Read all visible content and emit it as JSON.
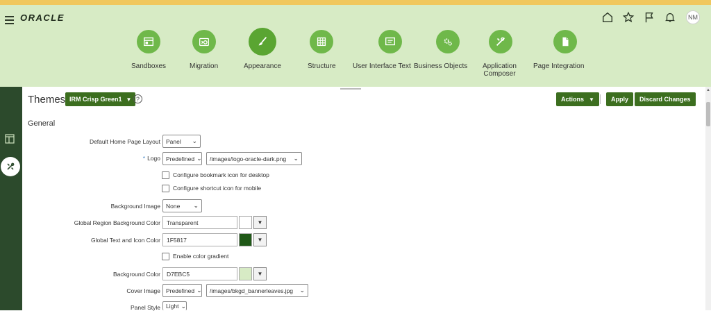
{
  "header": {
    "logo": "ORACLE",
    "avatar_initials": "NM",
    "icons": [
      "home-icon",
      "favorites-star-icon",
      "flag-icon",
      "notifications-bell-icon"
    ]
  },
  "nav": {
    "items": [
      {
        "label": "Sandboxes",
        "icon": "sandboxes-icon"
      },
      {
        "label": "Migration",
        "icon": "migration-icon"
      },
      {
        "label": "Appearance",
        "icon": "paintbrush-icon",
        "active": true
      },
      {
        "label": "Structure",
        "icon": "structure-grid-icon"
      },
      {
        "label": "User Interface Text",
        "icon": "ui-text-icon"
      },
      {
        "label": "Business Objects",
        "icon": "gears-icon"
      },
      {
        "label": "Application",
        "label2": "Composer",
        "icon": "tools-icon"
      },
      {
        "label": "Page Integration",
        "icon": "page-icon"
      }
    ]
  },
  "page": {
    "title": "Themes",
    "theme_selected": "IRM Crisp Green1",
    "help": "?",
    "actions_label": "Actions",
    "apply_label": "Apply",
    "discard_label": "Discard Changes",
    "section_title": "General"
  },
  "form": {
    "default_home_layout": {
      "label": "Default Home Page Layout",
      "value": "Panel"
    },
    "logo": {
      "label": "Logo",
      "required": "*",
      "type": "Predefined",
      "value": "/images/logo-oracle-dark.png"
    },
    "bookmark_icon": {
      "label": "Configure bookmark icon for desktop",
      "checked": false
    },
    "shortcut_icon": {
      "label": "Configure shortcut icon for mobile",
      "checked": false
    },
    "background_image": {
      "label": "Background Image",
      "value": "None"
    },
    "global_region_bg": {
      "label": "Global Region Background Color",
      "value": "Transparent",
      "swatch": "#ffffff"
    },
    "global_text_icon": {
      "label": "Global Text and Icon Color",
      "value": "1F5817",
      "swatch": "#1f5817"
    },
    "color_gradient": {
      "label": "Enable color gradient",
      "checked": false
    },
    "background_color": {
      "label": "Background Color",
      "value": "D7EBC5",
      "swatch": "#d7ebc5"
    },
    "cover_image": {
      "label": "Cover Image",
      "type": "Predefined",
      "value": "/images/bkgd_bannerleaves.jpg"
    },
    "panel_style": {
      "label": "Panel Style",
      "value": "Light"
    }
  },
  "colors": {
    "top_stripe": "#f0c75e",
    "header_bg": "#d7ebc5",
    "accent": "#3c6e1f",
    "nav_circle": "#6fb84a",
    "sidebar": "#2c4a2c"
  }
}
